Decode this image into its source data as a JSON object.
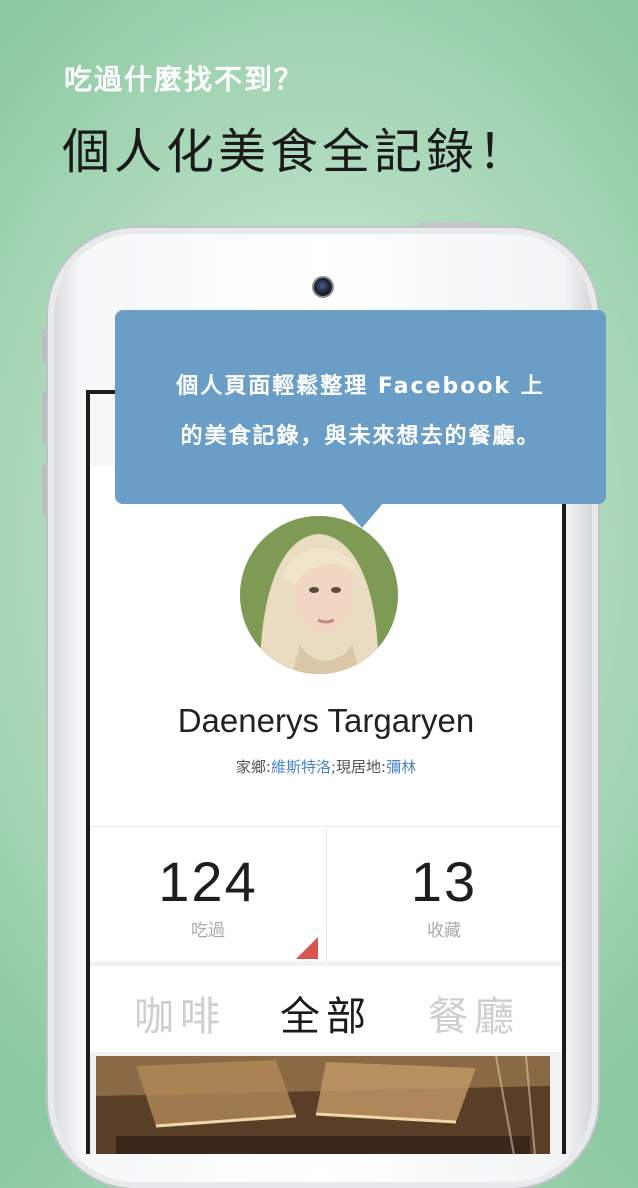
{
  "header": {
    "subtitle": "吃過什麼找不到？",
    "title": "個人化美食全記錄！"
  },
  "callout": {
    "line1": "個人頁面輕鬆整理 Facebook 上",
    "line2": "的美食記錄，與未來想去的餐廳。"
  },
  "profile": {
    "name": "Daenerys Targaryen",
    "hometown_label": "家鄉:",
    "hometown": "維斯特洛",
    "separator": ";",
    "current_label": "現居地:",
    "current": "彌林"
  },
  "stats": [
    {
      "value": "124",
      "label": "吃過"
    },
    {
      "value": "13",
      "label": "收藏"
    }
  ],
  "tabs": [
    {
      "label": "咖啡",
      "active": false
    },
    {
      "label": "全部",
      "active": true
    },
    {
      "label": "餐廳",
      "active": false
    }
  ],
  "colors": {
    "callout": "#6b9ec7",
    "accent_link": "#4a86c8",
    "indicator": "#d9534f",
    "background": "#9fd3b0"
  },
  "icons": {
    "camera": "front-camera-icon",
    "avatar": "user-avatar"
  }
}
